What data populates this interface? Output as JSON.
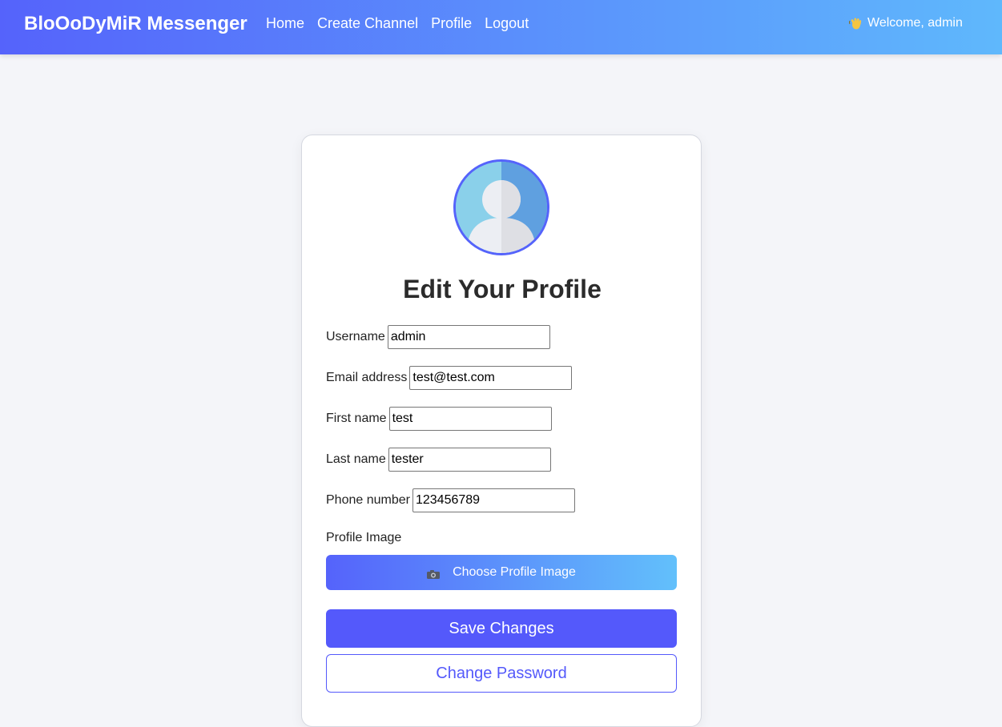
{
  "navbar": {
    "brand": "BloOoDyMiR Messenger",
    "links": [
      "Home",
      "Create Channel",
      "Profile",
      "Logout"
    ],
    "welcome_text": "Welcome, admin",
    "welcome_icon": "waving-hand-icon",
    "gradient": [
      "#5563fb",
      "#5fb8fc"
    ]
  },
  "profile": {
    "avatar_icon": "default-user-avatar",
    "title": "Edit Your Profile",
    "fields": [
      {
        "label": "Username",
        "value": "admin"
      },
      {
        "label": "Email address",
        "value": "test@test.com"
      },
      {
        "label": "First name",
        "value": "test"
      },
      {
        "label": "Last name",
        "value": "tester"
      },
      {
        "label": "Phone number",
        "value": "123456789"
      }
    ],
    "image_label": "Profile Image",
    "choose_image_label": "Choose Profile Image",
    "choose_image_icon": "camera-icon",
    "save_label": "Save Changes",
    "change_password_label": "Change Password"
  },
  "colors": {
    "accent": "#5459fb",
    "background": "#f4f5f9"
  }
}
